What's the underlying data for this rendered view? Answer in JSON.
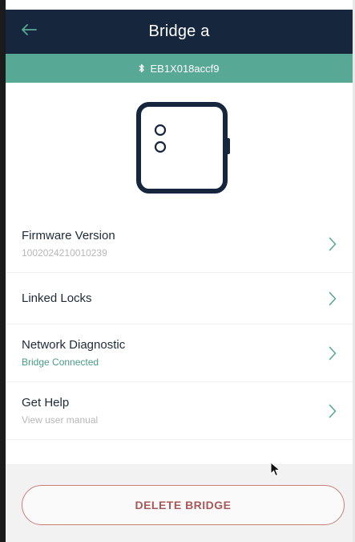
{
  "header": {
    "title": "Bridge a",
    "back_icon": "arrow-left-icon"
  },
  "bluetooth_bar": {
    "device_id": "EB1X018accf9",
    "icon": "bluetooth-icon"
  },
  "device": {
    "icon": "bridge-device-icon"
  },
  "settings": {
    "items": [
      {
        "label": "Firmware Version",
        "subtitle": "1002024210010239"
      },
      {
        "label": "Linked Locks",
        "subtitle": ""
      },
      {
        "label": "Network Diagnostic",
        "subtitle": "Bridge Connected"
      },
      {
        "label": "Get Help",
        "subtitle": "View user manual"
      }
    ]
  },
  "footer": {
    "delete_label": "DELETE BRIDGE"
  },
  "colors": {
    "header_bg": "#15263d",
    "accent_green": "#58a896",
    "status_green": "#4a9a86",
    "delete_red": "#a85858"
  }
}
